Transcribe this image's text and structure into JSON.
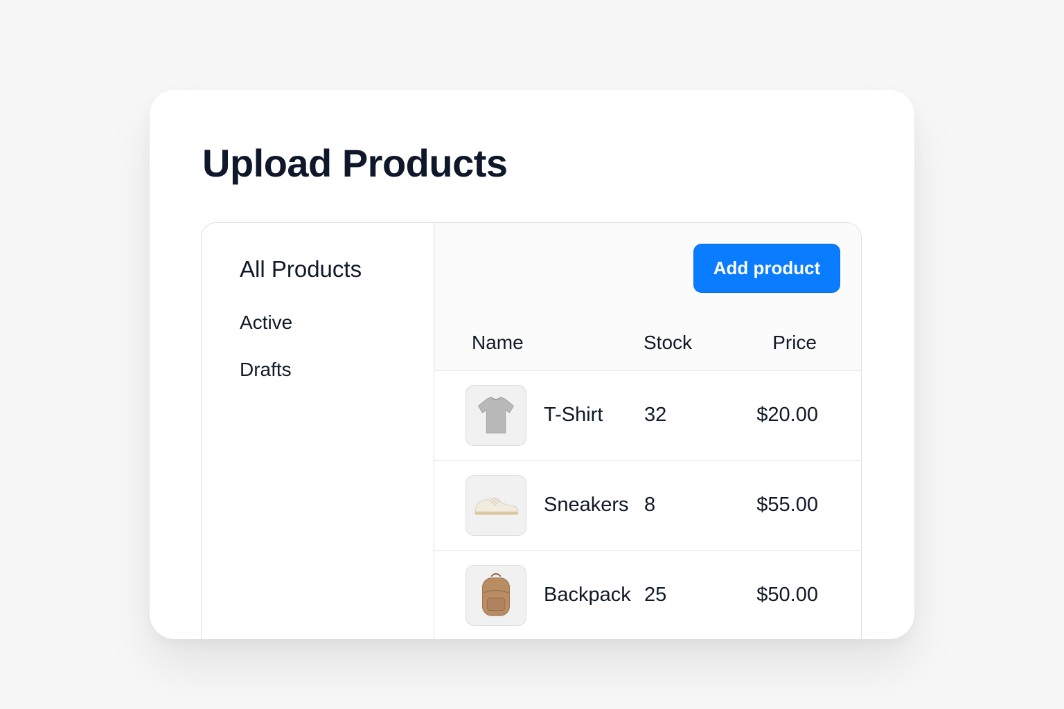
{
  "page": {
    "title": "Upload Products"
  },
  "sidebar": {
    "items": [
      {
        "label": "All Products"
      },
      {
        "label": "Active"
      },
      {
        "label": "Drafts"
      }
    ]
  },
  "toolbar": {
    "add_label": "Add product"
  },
  "table": {
    "columns": [
      "Name",
      "Stock",
      "Price"
    ],
    "rows": [
      {
        "name": "T-Shirt",
        "stock": "32",
        "price": "$20.00",
        "icon": "tshirt-icon"
      },
      {
        "name": "Sneakers",
        "stock": "8",
        "price": "$55.00",
        "icon": "sneaker-icon"
      },
      {
        "name": "Backpack",
        "stock": "25",
        "price": "$50.00",
        "icon": "backpack-icon"
      }
    ]
  },
  "colors": {
    "accent": "#0a7cff",
    "background": "#f7f7f7",
    "text": "#0f172a"
  }
}
